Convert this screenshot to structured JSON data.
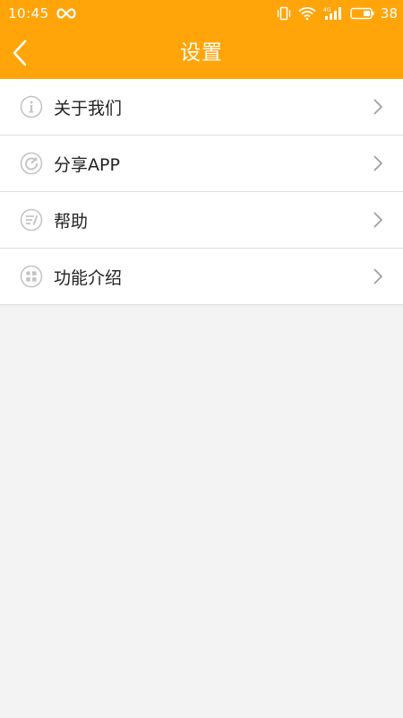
{
  "status_bar": {
    "time": "10:45",
    "battery_level": "38",
    "icons": [
      "infinity-icon",
      "vibrate-icon",
      "wifi-icon",
      "signal-4g-icon",
      "battery-icon"
    ]
  },
  "header": {
    "title": "设置",
    "back_icon": "chevron-left-icon"
  },
  "menu": {
    "items": [
      {
        "label": "关于我们",
        "icon": "info-icon"
      },
      {
        "label": "分享APP",
        "icon": "share-icon"
      },
      {
        "label": "帮助",
        "icon": "help-icon"
      },
      {
        "label": "功能介绍",
        "icon": "features-icon"
      }
    ]
  },
  "colors": {
    "accent": "#ffa50a",
    "background": "#f3f3f3",
    "icon_gray": "#c4c4c4",
    "chevron_gray": "#9a9a9a",
    "text": "#222222"
  }
}
